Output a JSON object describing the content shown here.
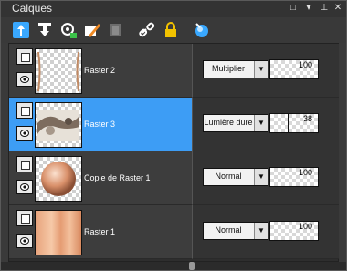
{
  "window": {
    "title": "Calques"
  },
  "toolbar": {
    "tools": [
      {
        "icon": "new-layer-icon"
      },
      {
        "icon": "merge-down-icon"
      },
      {
        "icon": "visibility-icon"
      },
      {
        "icon": "edit-mask-icon"
      },
      {
        "icon": "delete-layer-icon"
      },
      {
        "icon": "link-icon"
      },
      {
        "icon": "lock-icon"
      },
      {
        "icon": "blend-options-icon"
      }
    ]
  },
  "layers": [
    {
      "name": "Raster 2",
      "blend_mode": "Multiplier",
      "opacity": 100,
      "selected": false
    },
    {
      "name": "Raster 3",
      "blend_mode": "Lumière dure",
      "opacity": 38,
      "selected": true
    },
    {
      "name": "Copie de Raster 1",
      "blend_mode": "Normal",
      "opacity": 100,
      "selected": false
    },
    {
      "name": "Raster 1",
      "blend_mode": "Normal",
      "opacity": 100,
      "selected": false
    }
  ],
  "colors": {
    "selection": "#3d9df5",
    "panel": "#3a3a3a",
    "accent_icon": "#39a8ff"
  }
}
